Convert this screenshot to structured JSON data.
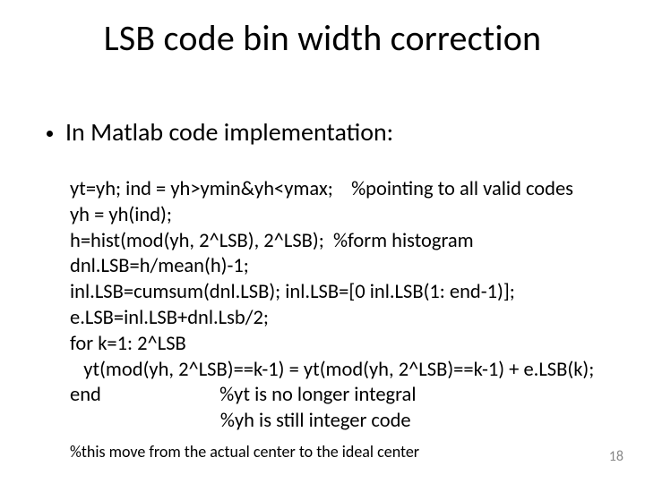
{
  "title": "LSB code bin width correction",
  "bullet": "In Matlab code implementation:",
  "code": {
    "l1": "yt=yh; ind = yh>ymin&yh<ymax;    %pointing to all valid codes",
    "l2": "yh = yh(ind);",
    "l3": "h=hist(mod(yh, 2^LSB), 2^LSB);  %form histogram",
    "l4": "dnl.LSB=h/mean(h)-1;",
    "l5": "inl.LSB=cumsum(dnl.LSB); inl.LSB=[0 inl.LSB(1: end-1)];",
    "l6": "e.LSB=inl.LSB+dnl.Lsb/2;",
    "l7": "for k=1: 2^LSB",
    "l8": "   yt(mod(yh, 2^LSB)==k-1) = yt(mod(yh, 2^LSB)==k-1) + e.LSB(k);",
    "l9": "end                          %yt is no longer integral",
    "l10": "                                 %yh is still integer code"
  },
  "footnote": "%this move from the actual center to the ideal center",
  "page_number": "18"
}
